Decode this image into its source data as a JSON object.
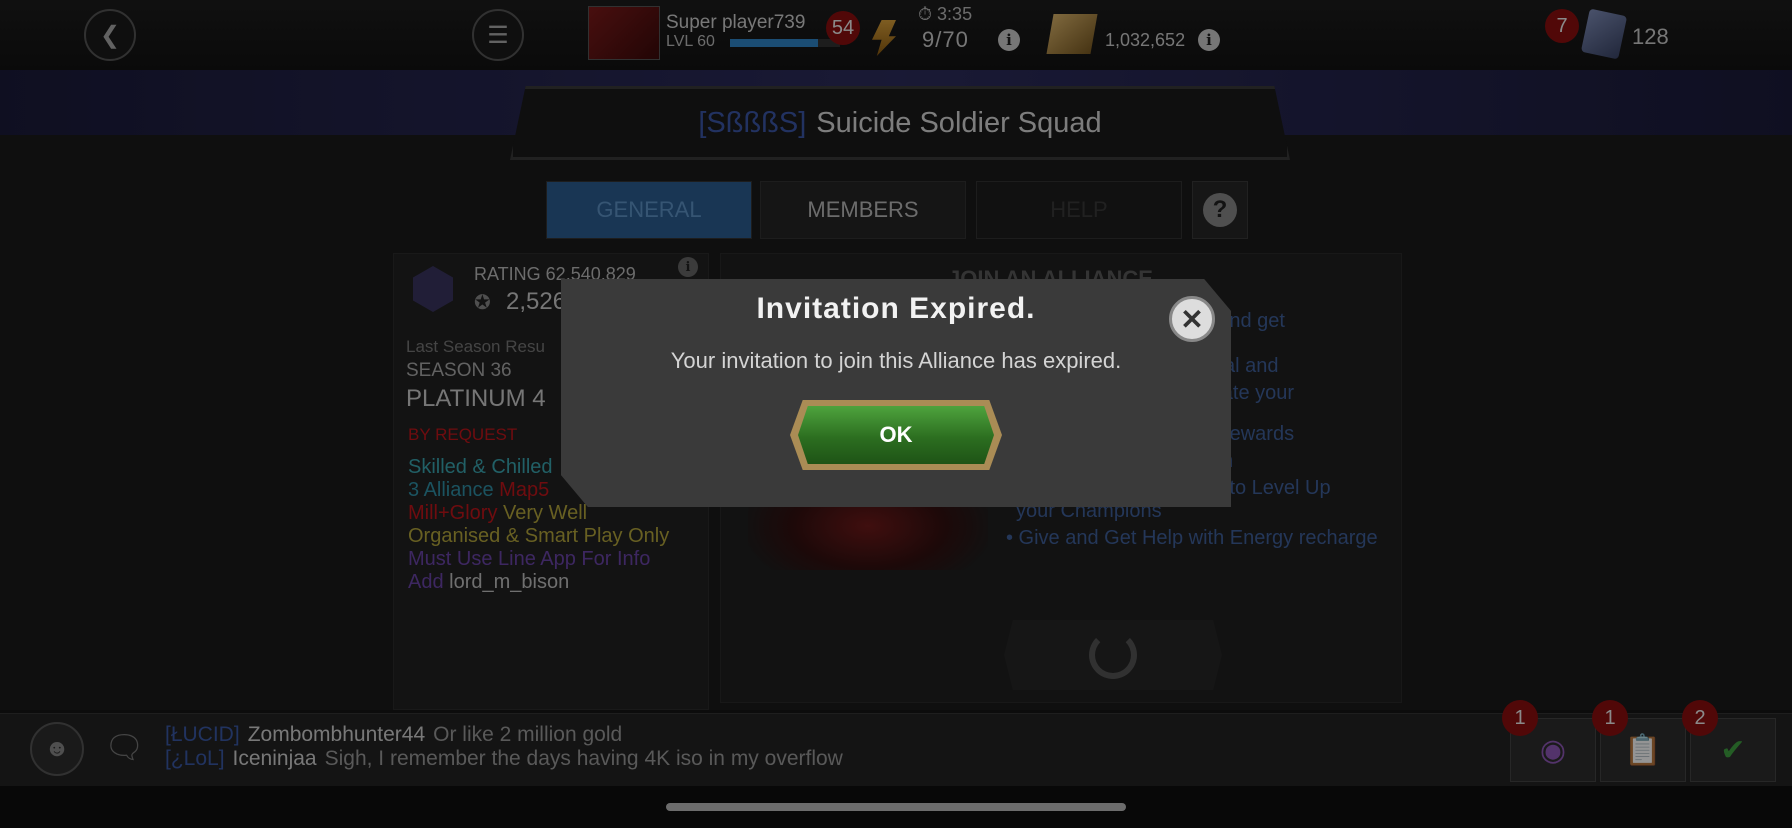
{
  "topbar": {
    "player_name": "Super player739",
    "level": "LVL 60",
    "xp_fraction": 0.8,
    "level_badge": "54",
    "energy_timer": "⏱ 3:35",
    "energy_count": "9/70",
    "gold_amount": "1,032,652",
    "units_badge": "7",
    "units_count": "128"
  },
  "alliance": {
    "tag": "[SßßßS]",
    "name": "Suicide Soldier Squad"
  },
  "tabs": {
    "general": "GENERAL",
    "members": "MEMBERS",
    "help": "HELP"
  },
  "left_panel": {
    "rating": "RATING 62,540,829",
    "trophies": "2,526",
    "last_season_label": "Last Season Resu",
    "season": "SEASON 36",
    "tier": "PLATINUM 4",
    "by_request": "BY REQUEST",
    "desc": [
      {
        "text": " Skilled & Chilled",
        "color": "#3aa5b0"
      },
      {
        "text": "3 Alliance",
        "color": "#2f8fa6"
      },
      {
        "text": " Map5",
        "color": "#c0151a"
      },
      {
        "text": "Mill+Glory",
        "color": "#c0151a"
      },
      {
        "text": " Very Well",
        "color": "#b3a53c"
      },
      {
        "text": "Organised & Smart Play Only",
        "color": "#b3a53c"
      },
      {
        "text": "Must Use Line App For Info",
        "color": "#6a44a8"
      },
      {
        "text": "Add",
        "color": "#6a44a8"
      },
      {
        "text": " lord_m_bison",
        "color": "#bfbfbf"
      }
    ]
  },
  "right_panel": {
    "join_title": "JOIN AN ALLIANCE",
    "benefits": [
      "now and get",
      "ro Crystal and",
      "n or create your",
      "nt and Rewards",
      "n",
      "Get Alliance Resources to Level Up your Champions",
      "• Give and Get Help with Energy recharge"
    ]
  },
  "modal": {
    "title": "Invitation Expired.",
    "message": "Your invitation to join this Alliance has expired.",
    "ok_label": "OK"
  },
  "chat": [
    {
      "tag": "[ŁUCID]",
      "name": "Zombombhunter44",
      "message": "Or like 2 million gold"
    },
    {
      "tag": "[¿LoL]",
      "name": "Iceninjaa",
      "message": "Sigh, I remember the days having 4K iso in my overflow"
    }
  ],
  "bottom_buttons": {
    "quests_badge": "1",
    "notes_badge": "1",
    "check_badge": "2"
  },
  "icons": {
    "back": "back-arrow-icon",
    "menu": "hamburger-menu-icon",
    "energy": "energy-bolt-icon",
    "gold": "gold-icon",
    "units": "units-card-icon",
    "close": "close-icon",
    "people": "people-icon",
    "chat": "speech-bubble-icon",
    "quest": "mask-icon",
    "notes": "clipboard-icon",
    "check": "checkmark-icon"
  }
}
